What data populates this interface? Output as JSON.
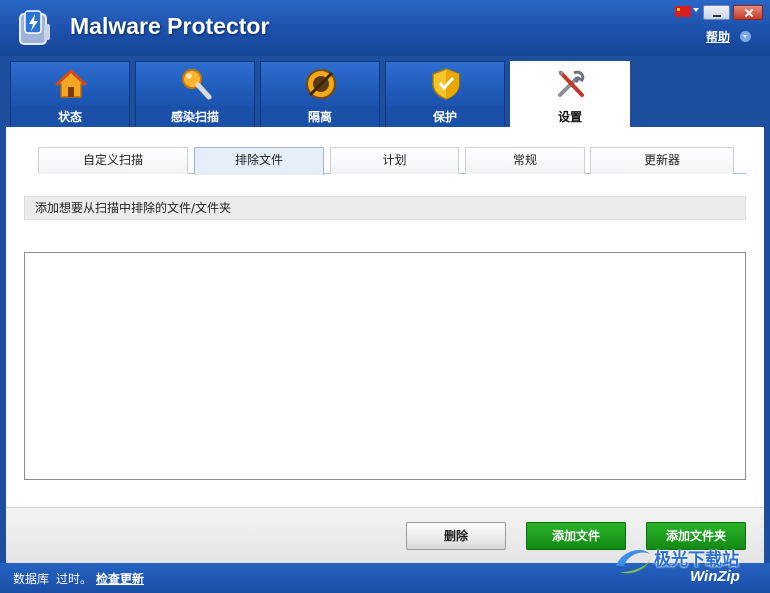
{
  "app": {
    "title": "Malware Protector",
    "help_label": "帮助",
    "icon": "shield-app-icon"
  },
  "main_tabs": [
    {
      "label": "状态",
      "icon": "home-icon",
      "active": false
    },
    {
      "label": "感染扫描",
      "icon": "magnifier-icon",
      "active": false
    },
    {
      "label": "隔离",
      "icon": "quarantine-icon",
      "active": false
    },
    {
      "label": "保护",
      "icon": "shield-icon",
      "active": false
    },
    {
      "label": "设置",
      "icon": "tools-icon",
      "active": true
    }
  ],
  "sub_tabs": [
    {
      "label": "自定义扫描",
      "active": false
    },
    {
      "label": "排除文件",
      "active": true
    },
    {
      "label": "计划",
      "active": false
    },
    {
      "label": "常规",
      "active": false
    },
    {
      "label": "更新器",
      "active": false
    }
  ],
  "exclusions": {
    "info_text": "添加想要从扫描中排除的文件/文件夹",
    "items": []
  },
  "actions": {
    "delete_label": "删除",
    "add_file_label": "添加文件",
    "add_folder_label": "添加文件夹"
  },
  "status": {
    "db_label": "数据库",
    "db_status": "过时。",
    "update_link": "检查更新"
  },
  "watermark": {
    "site_text": "极光下载站",
    "brand_text": "WinZip"
  },
  "colors": {
    "title_blue": "#1b4fa8",
    "tab_blue": "#1e57b5",
    "button_green": "#138a13",
    "status_blue": "#1a4ea5"
  }
}
